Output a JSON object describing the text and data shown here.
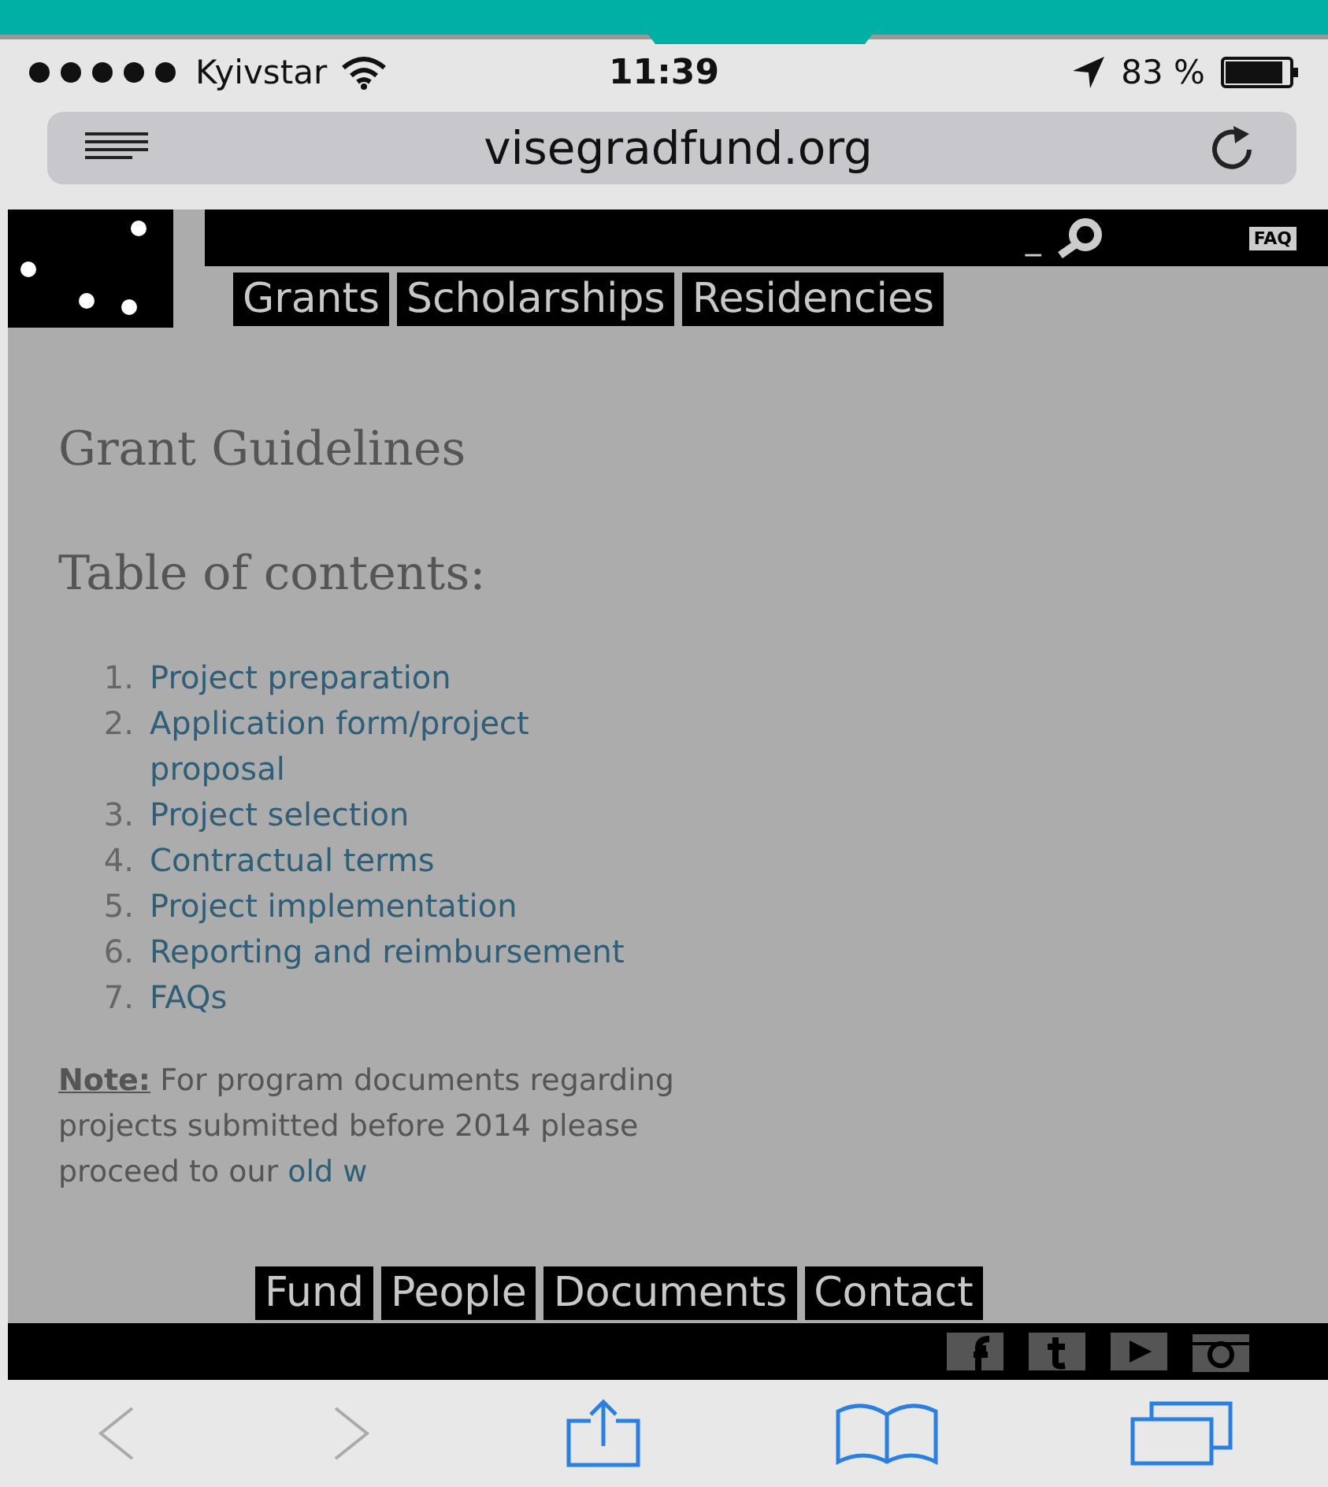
{
  "status_bar": {
    "carrier": "Kyivstar",
    "time": "11:39",
    "battery": "83 %"
  },
  "address_bar": {
    "url": "visegradfund.org"
  },
  "site_header": {
    "faq": "FAQ",
    "search_mark": "_",
    "nav": [
      "Grants",
      "Scholarships",
      "Residencies"
    ]
  },
  "content": {
    "title": "Grant Guidelines",
    "toc_heading": "Table of contents:",
    "toc": [
      {
        "number": "1.",
        "text": "Project preparation"
      },
      {
        "number": "2.",
        "text": "Application form/project proposal"
      },
      {
        "number": "3.",
        "text": "Project selection"
      },
      {
        "number": "4.",
        "text": "Contractual terms"
      },
      {
        "number": "5.",
        "text": "Project implementation"
      },
      {
        "number": "6.",
        "text": "Reporting and reimbursement"
      },
      {
        "number": "7.",
        "text": "FAQs"
      }
    ],
    "note": {
      "label": "Note:",
      "text": "For program documents regarding projects submitted before 2014 please proceed to our",
      "link": "old w"
    }
  },
  "footer_nav": [
    "Fund",
    "People",
    "Documents",
    "Contact"
  ]
}
